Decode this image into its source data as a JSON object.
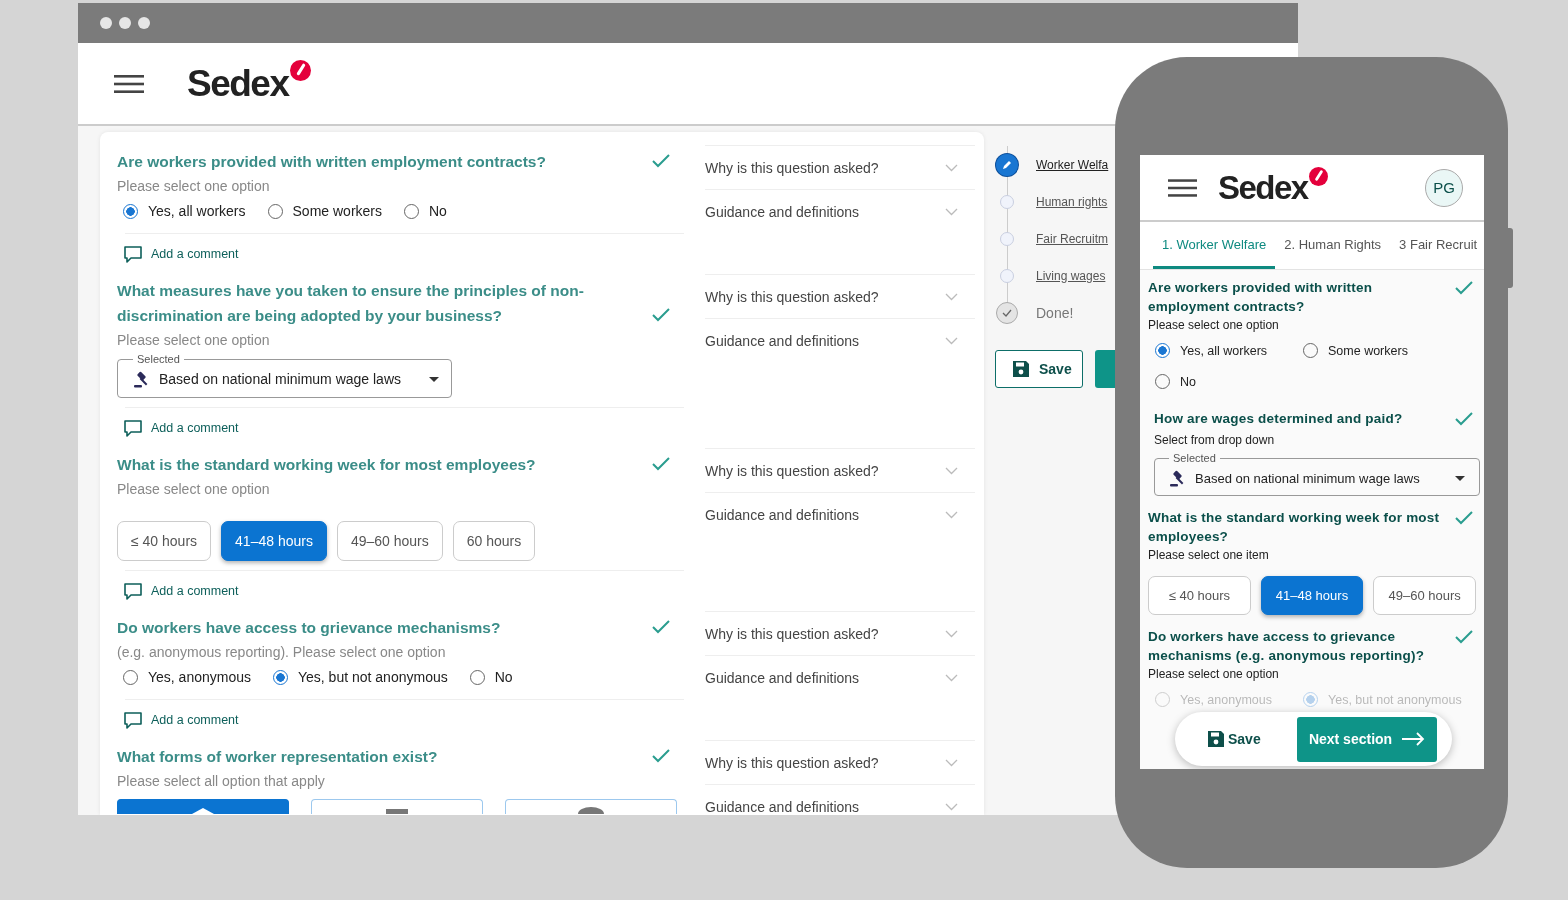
{
  "browser": {
    "brand": "Sedex"
  },
  "questions": [
    {
      "kind": "radio",
      "title": "Are workers provided with written employment contracts?",
      "hint": "Please select one option",
      "answered": true,
      "options": [
        {
          "label": "Yes, all workers",
          "selected": true
        },
        {
          "label": "Some workers",
          "selected": false
        },
        {
          "label": "No",
          "selected": false
        }
      ],
      "comment": "Add a comment",
      "help": [
        "Why is this question asked?",
        "Guidance and definitions"
      ]
    },
    {
      "kind": "select",
      "title": "What measures have you taken to ensure the principles of non-discrimination are being adopted by your business?",
      "hint": "Please select one option",
      "answered": true,
      "select": {
        "legend": "Selected",
        "value": "Based on national minimum wage laws"
      },
      "comment": "Add a comment",
      "help": [
        "Why is this question asked?",
        "Guidance and definitions"
      ]
    },
    {
      "kind": "chips",
      "title": "What is the standard working week for most employees?",
      "hint": "Please select one option",
      "answered": true,
      "options": [
        {
          "label": "≤ 40 hours",
          "selected": false
        },
        {
          "label": "41–48 hours",
          "selected": true
        },
        {
          "label": "49–60 hours",
          "selected": false
        },
        {
          "label": "60 hours",
          "selected": false
        }
      ],
      "comment": "Add a comment",
      "help": [
        "Why is this question asked?",
        "Guidance and definitions"
      ]
    },
    {
      "kind": "radio",
      "title": "Do workers have access to grievance mechanisms?",
      "hint": "(e.g. anonymous reporting). Please select one option",
      "answered": true,
      "options": [
        {
          "label": "Yes, anonymous",
          "selected": false
        },
        {
          "label": "Yes, but not anonymous",
          "selected": true
        },
        {
          "label": "No",
          "selected": false
        }
      ],
      "comment": "Add a comment",
      "help": [
        "Why is this question asked?",
        "Guidance and definitions"
      ]
    },
    {
      "kind": "cards",
      "title": "What forms of worker representation exist?",
      "hint": "Please select all option that apply",
      "answered": true,
      "options": [
        {
          "selected": true
        },
        {
          "selected": false
        },
        {
          "selected": false
        }
      ],
      "help": [
        "Why is this question asked?",
        "Guidance and definitions"
      ]
    }
  ],
  "stepper": {
    "steps": [
      {
        "label": "Worker Welfa",
        "kind": "current"
      },
      {
        "label": "Human rights",
        "kind": "pending"
      },
      {
        "label": "Fair Recruitm",
        "kind": "pending"
      },
      {
        "label": "Living wages",
        "kind": "pending"
      },
      {
        "label": "Done!",
        "kind": "finish"
      }
    ],
    "save": "Save"
  },
  "phone": {
    "brand": "Sedex",
    "avatar": "PG",
    "tabs": [
      {
        "label": "1. Worker Welfare",
        "selected": true
      },
      {
        "label": "2. Human Rights",
        "selected": false
      },
      {
        "label": "3 Fair Recruit",
        "selected": false
      }
    ],
    "questions": [
      {
        "kind": "radio",
        "title": "Are workers provided with written employment contracts?",
        "hint": "Please select one option",
        "answered": true,
        "options": [
          {
            "label": "Yes, all workers",
            "selected": true
          },
          {
            "label": "Some workers",
            "selected": false
          },
          {
            "label": "No",
            "selected": false
          }
        ]
      },
      {
        "kind": "select",
        "title": "How are wages determined and paid?",
        "hint": "Select from drop down",
        "answered": true,
        "select": {
          "legend": "Selected",
          "value": "Based on national minimum wage laws"
        }
      },
      {
        "kind": "chips",
        "title": "What is the standard working week for most employees?",
        "hint": "Please select one item",
        "answered": true,
        "options": [
          {
            "label": "≤ 40 hours",
            "selected": false
          },
          {
            "label": "41–48 hours",
            "selected": true
          },
          {
            "label": "49–60 hours",
            "selected": false
          }
        ]
      },
      {
        "kind": "radio",
        "title": "Do workers have access to grievance mechanisms (e.g. anonymous reporting)?",
        "hint": "Please select one option",
        "answered": true,
        "faded": true,
        "options": [
          {
            "label": "Yes, anonymous",
            "selected": false
          },
          {
            "label": "Yes, but not anonymous",
            "selected": true
          }
        ]
      }
    ],
    "save": "Save",
    "next": "Next section"
  }
}
